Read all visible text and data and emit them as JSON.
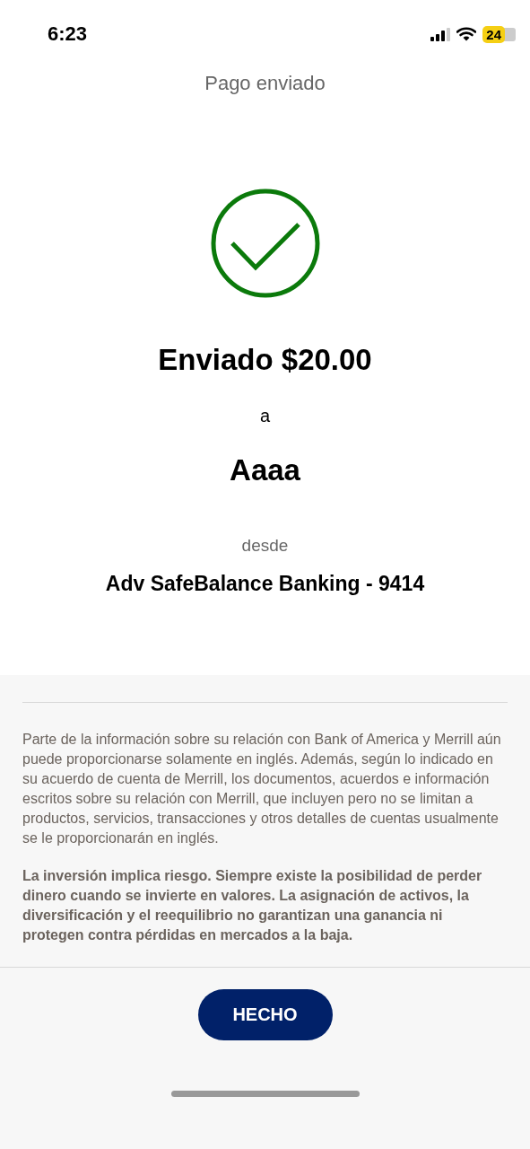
{
  "status_bar": {
    "time": "6:23",
    "battery": "24"
  },
  "title": "Pago enviado",
  "confirmation": {
    "amount": "Enviado $20.00",
    "connector": "a",
    "recipient": "Aaaa",
    "from_label": "desde",
    "account": "Adv SafeBalance Banking - 9414"
  },
  "disclosures": [
    {
      "kind": "normal",
      "text": "Parte de la información sobre su relación con Bank of America y Merrill aún puede proporcionarse solamente en inglés. Además, según lo indicado en su acuerdo de cuenta de Merrill, los documentos, acuerdos e información escritos sobre su relación con Merrill, que incluyen pero no se limitan a productos, servicios, transacciones y otros detalles de cuentas usualmente se le proporcionarán en inglés."
    },
    {
      "kind": "bold",
      "text": "La inversión implica riesgo. Siempre existe la posibilidad de perder dinero cuando se invierte en valores. La asignación de activos, la diversificación y el reequilibrio no garantizan una ganancia ni protegen contra pérdidas en mercados a la baja."
    }
  ],
  "button": "HECHO"
}
